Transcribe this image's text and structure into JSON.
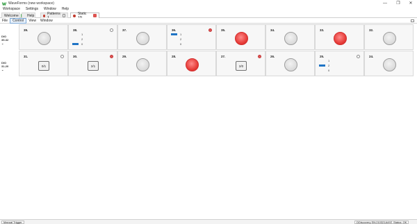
{
  "window": {
    "title": "WaveForms  (new workspace)",
    "minimize": "—",
    "maximize": "❐",
    "close": "✕"
  },
  "menu": [
    "Workspace",
    "Settings",
    "Window",
    "Help"
  ],
  "tabs": {
    "welcome": "Welcome",
    "help": "Help",
    "patterns": "Patterns 1",
    "static": "Static 1D"
  },
  "submenu": [
    "File",
    "Control",
    "View",
    "Window"
  ],
  "rows": [
    {
      "label": "DIO",
      "sub": "39-32",
      "cells": [
        {
          "num": "39.",
          "type": "led",
          "on": false
        },
        {
          "num": "38.",
          "type": "slider",
          "corner": "off",
          "ticks": [
            "1",
            "2",
            "0"
          ],
          "value": 0
        },
        {
          "num": "37.",
          "type": "led",
          "on": false
        },
        {
          "num": "36.",
          "type": "slider",
          "corner": "red",
          "ticks": [
            "1",
            "2",
            "0"
          ],
          "value": 1
        },
        {
          "num": "35.",
          "type": "led",
          "on": true
        },
        {
          "num": "34.",
          "type": "led",
          "on": false
        },
        {
          "num": "33.",
          "type": "led",
          "on": true
        },
        {
          "num": "32.",
          "type": "led",
          "on": false
        }
      ]
    },
    {
      "label": "DIO",
      "sub": "31-20",
      "cells": [
        {
          "num": "31.",
          "type": "button",
          "text": "0/1",
          "corner": "off"
        },
        {
          "num": "30.",
          "type": "button",
          "text": "2/1",
          "corner": "red"
        },
        {
          "num": "29.",
          "type": "led",
          "on": false
        },
        {
          "num": "28.",
          "type": "led",
          "on": true
        },
        {
          "num": "27.",
          "type": "button",
          "text": "2/0",
          "corner": "red"
        },
        {
          "num": "26.",
          "type": "led",
          "on": false
        },
        {
          "num": "25.",
          "type": "slider",
          "corner": "off",
          "ticks": [
            "1",
            "2",
            "0"
          ],
          "value": 2
        },
        {
          "num": "24.",
          "type": "led",
          "on": false
        }
      ]
    }
  ],
  "status": {
    "trigger": "Manual Trigger",
    "device": "DDiscovery SN:210321A493E",
    "status": "Status: OK"
  },
  "colors": {
    "led_on": "#e53935",
    "slider_bar": "#1f74c5",
    "corner_red": "#e05454"
  }
}
